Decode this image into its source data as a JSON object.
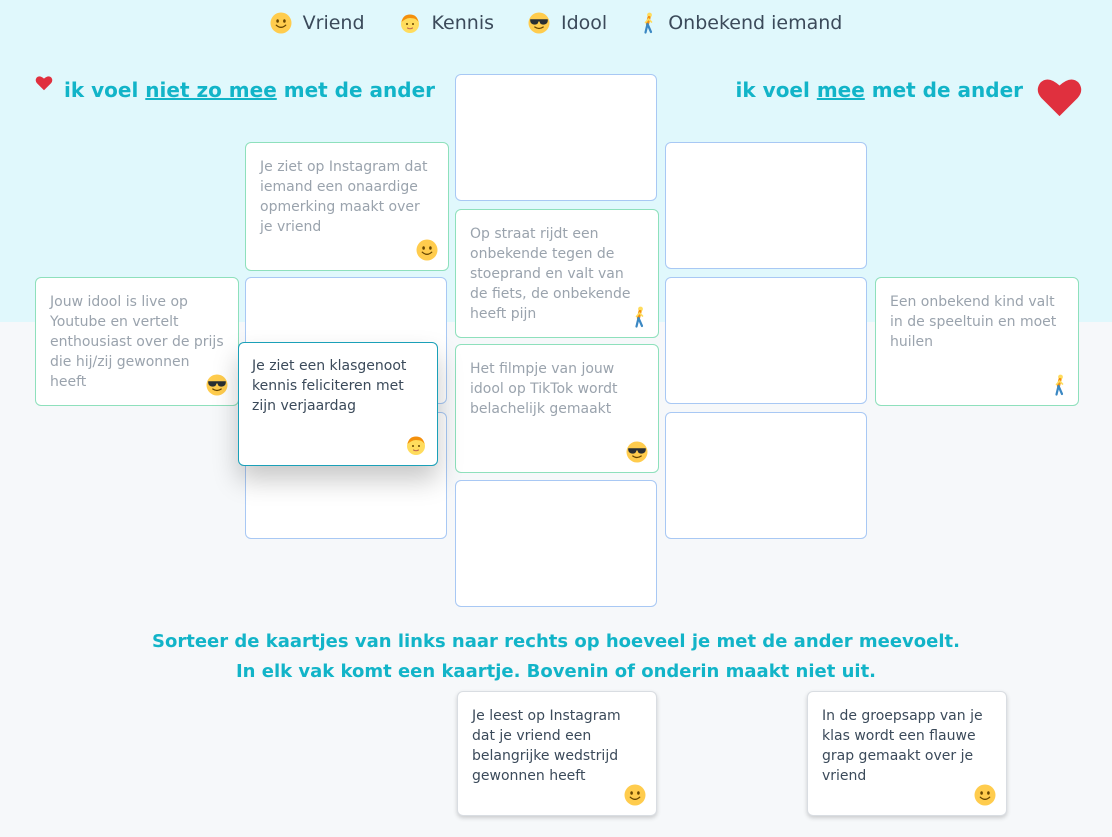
{
  "legend": [
    {
      "icon": "smiley-icon",
      "label": "Vriend"
    },
    {
      "icon": "child-face-icon",
      "label": "Kennis"
    },
    {
      "icon": "sunglasses-face-icon",
      "label": "Idool"
    },
    {
      "icon": "walking-person-icon",
      "label": "Onbekend iemand"
    }
  ],
  "header": {
    "left": {
      "prefix": "ik voel ",
      "emphasis": "niet zo mee",
      "suffix": " met de ander"
    },
    "right": {
      "prefix": "ik voel ",
      "emphasis": "mee",
      "suffix": " met de ander"
    }
  },
  "cards": {
    "c1": {
      "text": "Je ziet op Instagram dat iemand een onaardige opmerking maakt over je vriend",
      "icon": "smiley-icon"
    },
    "c2": {
      "text": "Op straat rijdt een onbekende tegen de stoeprand en valt van de fiets, de onbekende heeft pijn",
      "icon": "walking-person-icon"
    },
    "c3": {
      "text": "Jouw idool is live op Youtube en vertelt enthousiast over de prijs die hij/zij gewonnen heeft",
      "icon": "sunglasses-face-icon"
    },
    "c4": {
      "text": "Je ziet een klasgenoot kennis feliciteren met zijn verjaardag",
      "icon": "child-face-icon"
    },
    "c5": {
      "text": "Het filmpje van jouw idool op TikTok wordt belachelijk gemaakt",
      "icon": "sunglasses-face-icon"
    },
    "c6": {
      "text": "Een onbekend kind valt in de speeltuin en moet huilen",
      "icon": "walking-person-icon"
    },
    "c7": {
      "text": "Je leest op Instagram dat je vriend een belangrijke wedstrijd gewonnen heeft",
      "icon": "smiley-icon"
    },
    "c8": {
      "text": "In de groepsapp van je klas wordt een flauwe grap gemaakt over je vriend",
      "icon": "smiley-icon"
    }
  },
  "instructions": {
    "line1": "Sorteer de kaartjes van links naar rechts op hoeveel je met de ander meevoelt.",
    "line2": "In elk vak komt een kaartje. Bovenin of onderin maakt niet uit."
  },
  "colors": {
    "accent": "#12b4c8",
    "heart": "#e0303e",
    "slot_border": "#a8c8f4",
    "placed_border": "#8ee0bc"
  }
}
